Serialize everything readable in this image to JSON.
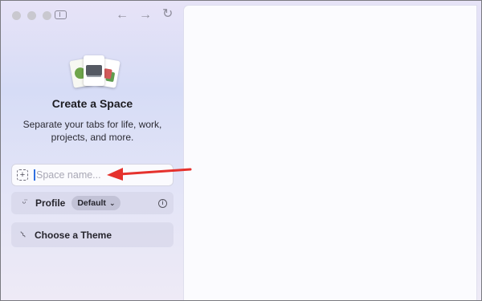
{
  "window": {
    "traffic_lights": [
      "close",
      "minimize",
      "zoom"
    ],
    "toolbar_icons": [
      "sidebar-toggle-icon",
      "back-arrow-icon",
      "forward-arrow-icon",
      "reload-icon"
    ]
  },
  "create_space": {
    "title": "Create a Space",
    "subtitle": "Separate your tabs for life, work, projects, and more.",
    "name_field": {
      "value": "",
      "placeholder": "Space name...",
      "icon": "plus-dashed-icon",
      "add_symbol": "+"
    },
    "profile": {
      "label": "Profile",
      "selected": "Default",
      "icon": "smile-icon",
      "chevron": "⌄",
      "info_symbol": "i"
    },
    "theme": {
      "label": "Choose a Theme",
      "icon": "brush-icon"
    }
  },
  "glyphs": {
    "back": "←",
    "forward": "→",
    "reload": "↻",
    "smile": "ᵕ̈",
    "brush": "⌇"
  },
  "colors": {
    "accent": "#2f6fe0",
    "annotation_arrow": "#e5322d"
  }
}
